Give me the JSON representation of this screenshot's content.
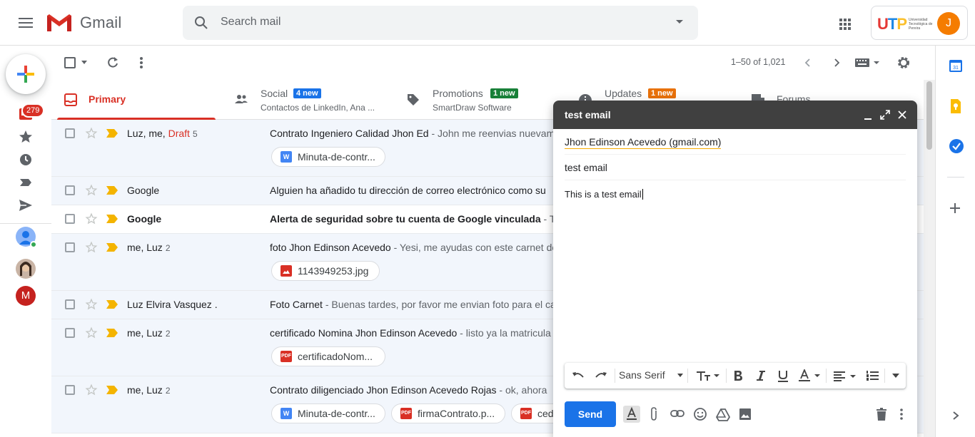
{
  "app": {
    "brand": "Gmail"
  },
  "search": {
    "placeholder": "Search mail"
  },
  "account": {
    "org_logo": "UTP",
    "org_name": "Universidad Tecnológica de Pereira",
    "avatar_letter": "J"
  },
  "rail": {
    "inbox_count": "279",
    "hangout_avatar_letter": "M"
  },
  "toolbar": {
    "pagination": "1–50 of 1,021"
  },
  "tabs": [
    {
      "label": "Primary",
      "sub": "",
      "badge": ""
    },
    {
      "label": "Social",
      "sub": "Contactos de LinkedIn, Ana ...",
      "badge": "4 new",
      "badge_color": "#1a73e8"
    },
    {
      "label": "Promotions",
      "sub": "SmartDraw Software",
      "badge": "1 new",
      "badge_color": "#188038"
    },
    {
      "label": "Updates",
      "sub": "",
      "badge": "1 new",
      "badge_color": "#e8710a"
    },
    {
      "label": "Forums",
      "sub": "",
      "badge": ""
    }
  ],
  "emails": [
    {
      "sender": "Luz, me, ",
      "draft": "Draft",
      "count": "5",
      "subject": "Contrato Ingeniero Calidad Jhon Ed",
      "snippet": " - John me reenvias nuevamente",
      "unread": false,
      "attachments": [
        {
          "name": "Minuta-de-contr...",
          "type": "W",
          "color": "#4285f4"
        }
      ]
    },
    {
      "sender": "Google",
      "draft": "",
      "count": "",
      "subject": "Alguien ha añadido tu dirección de correo electrónico como su",
      "snippet": "",
      "unread": false,
      "attachments": []
    },
    {
      "sender": "Google",
      "draft": "",
      "count": "",
      "subject": "Alerta de seguridad sobre tu cuenta de Google vinculada",
      "snippet": " - Tu",
      "unread": true,
      "attachments": []
    },
    {
      "sender": "me, Luz",
      "draft": "",
      "count": "2",
      "subject": "foto Jhon Edinson Acevedo",
      "snippet": " - Yesi, me ayudas con este carnet de",
      "unread": false,
      "attachments": [
        {
          "name": "1143949253.jpg",
          "type": "img",
          "color": "#d93025"
        }
      ]
    },
    {
      "sender": "Luz Elvira Vasquez .",
      "draft": "",
      "count": "",
      "subject": "Foto Carnet",
      "snippet": " - Buenas tardes, por favor me envian foto para el carnet",
      "unread": false,
      "attachments": []
    },
    {
      "sender": "me, Luz",
      "draft": "",
      "count": "2",
      "subject": "certificado Nomina Jhon Edinson Acevedo",
      "snippet": " - listo ya la matricula",
      "unread": false,
      "attachments": [
        {
          "name": "certificadoNom...",
          "type": "PDF",
          "color": "#d93025"
        }
      ]
    },
    {
      "sender": "me, Luz",
      "draft": "",
      "count": "2",
      "subject": "Contrato diligenciado Jhon Edinson Acevedo Rojas",
      "snippet": " - ok, ahora",
      "unread": false,
      "attachments": [
        {
          "name": "Minuta-de-contr...",
          "type": "W",
          "color": "#4285f4"
        },
        {
          "name": "firmaContrato.p...",
          "type": "PDF",
          "color": "#d93025"
        },
        {
          "name": "ced",
          "type": "PDF",
          "color": "#d93025"
        }
      ]
    }
  ],
  "compose": {
    "title": "test email",
    "to": "Jhon Edinson Acevedo (gmail.com)",
    "subject": "test email",
    "body": "This is a test email",
    "font": "Sans Serif",
    "send_label": "Send"
  },
  "colors": {
    "primary_red": "#d93025",
    "send_blue": "#1a73e8",
    "compose_header": "#404040"
  }
}
